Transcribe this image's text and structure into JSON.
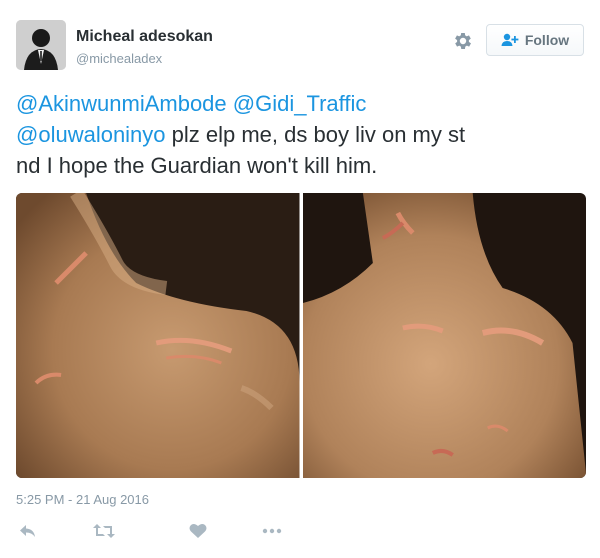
{
  "author": {
    "name": "Micheal adesokan",
    "handle": "@michealadex"
  },
  "header": {
    "follow_label": "Follow"
  },
  "tweet": {
    "mention_1": "@AkinwunmiAmbode",
    "mention_2": "@Gidi_Traffic",
    "mention_3": "@oluwaloninyo",
    "text_line_2": " plz elp me, ds boy liv on my st",
    "text_line_3": "nd I hope the Guardian won't kill him.",
    "timestamp": "5:25 PM - 21 Aug 2016"
  },
  "icons": {
    "settings": "gear-icon",
    "follow": "add-user-icon",
    "reply": "reply-icon",
    "retweet": "retweet-icon",
    "like": "heart-icon",
    "more": "more-icon"
  },
  "colors": {
    "link": "#1b95e0",
    "text": "#292f33",
    "muted": "#8899a6",
    "action_icon": "#aab8c2"
  }
}
